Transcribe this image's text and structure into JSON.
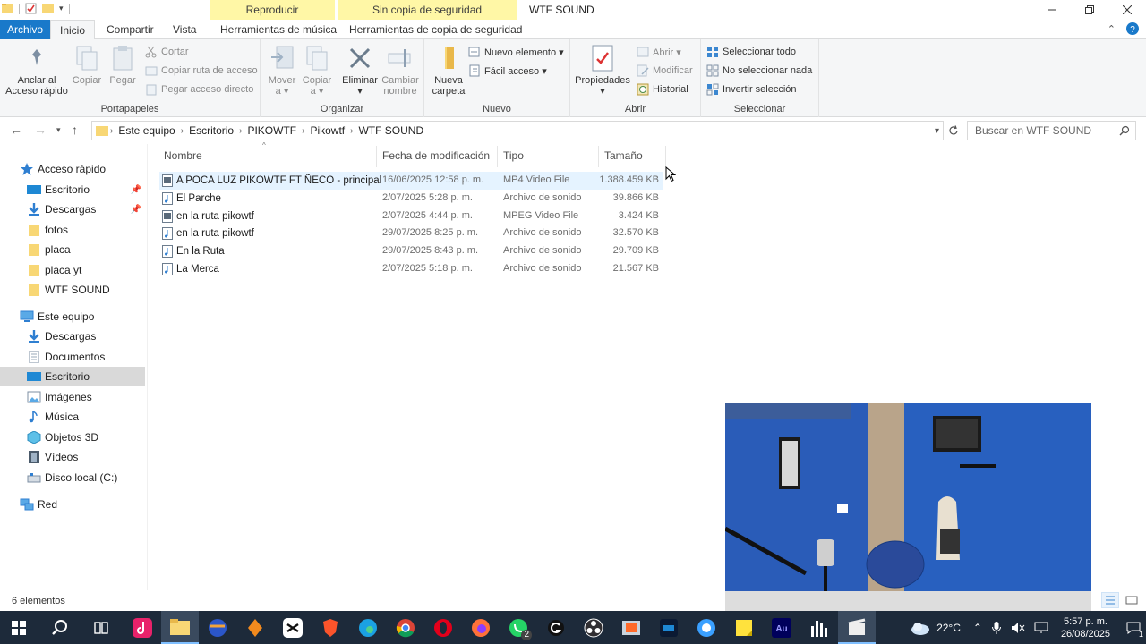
{
  "titlebar": {
    "context_tab_1": "Reproducir",
    "context_tab_2": "Sin copia de seguridad",
    "window_title": "WTF SOUND"
  },
  "tabs": {
    "file": "Archivo",
    "home": "Inicio",
    "share": "Compartir",
    "view": "Vista",
    "music_tools": "Herramientas de música",
    "backup_tools": "Herramientas de copia de seguridad"
  },
  "ribbon": {
    "clipboard": {
      "label": "Portapapeles",
      "pin_quick_access": [
        "Anclar al",
        "Acceso rápido"
      ],
      "copy": "Copiar",
      "paste": "Pegar",
      "cut": "Cortar",
      "copy_path": "Copiar ruta de acceso",
      "paste_shortcut": "Pegar acceso directo"
    },
    "organize": {
      "label": "Organizar",
      "move_to": [
        "Mover",
        "a ▾"
      ],
      "copy_to": [
        "Copiar",
        "a ▾"
      ],
      "delete": [
        "Eliminar",
        "▾"
      ],
      "rename": [
        "Cambiar",
        "nombre"
      ]
    },
    "new": {
      "label": "Nuevo",
      "new_folder": [
        "Nueva",
        "carpeta"
      ],
      "new_item": "Nuevo elemento ▾",
      "easy_access": "Fácil acceso ▾"
    },
    "open": {
      "label": "Abrir",
      "properties": [
        "Propiedades",
        "▾"
      ],
      "open": "Abrir ▾",
      "edit": "Modificar",
      "history": "Historial"
    },
    "select": {
      "label": "Seleccionar",
      "select_all": "Seleccionar todo",
      "select_none": "No seleccionar nada",
      "invert": "Invertir selección"
    }
  },
  "address": {
    "crumbs": [
      "Este equipo",
      "Escritorio",
      "PIKOWTF",
      "Pikowtf",
      "WTF SOUND"
    ],
    "search_placeholder": "Buscar en WTF SOUND"
  },
  "nav": {
    "quick_access": "Acceso rápido",
    "quick_items": [
      "Escritorio",
      "Descargas",
      "fotos",
      "placa",
      "placa yt",
      "WTF SOUND"
    ],
    "this_pc": "Este equipo",
    "pc_items": [
      "Descargas",
      "Documentos",
      "Escritorio",
      "Imágenes",
      "Música",
      "Objetos 3D",
      "Vídeos",
      "Disco local (C:)"
    ],
    "network": "Red"
  },
  "columns": {
    "name": "Nombre",
    "date": "Fecha de modificación",
    "type": "Tipo",
    "size": "Tamaño"
  },
  "files": [
    {
      "name": "A POCA LUZ PIKOWTF FT ÑECO - principal",
      "date": "16/06/2025 12:58 p. m.",
      "type": "MP4 Video File",
      "size": "1.388.459 KB",
      "icon": "video-file-icon"
    },
    {
      "name": "El Parche",
      "date": "2/07/2025 5:28 p. m.",
      "type": "Archivo de sonido",
      "size": "39.866 KB",
      "icon": "audio-file-icon"
    },
    {
      "name": "en la ruta pikowtf",
      "date": "2/07/2025 4:44 p. m.",
      "type": "MPEG Video File",
      "size": "3.424 KB",
      "icon": "video-file-icon"
    },
    {
      "name": "en la ruta pikowtf",
      "date": "29/07/2025 8:25 p. m.",
      "type": "Archivo de sonido",
      "size": "32.570 KB",
      "icon": "audio-file-icon"
    },
    {
      "name": "En la Ruta",
      "date": "29/07/2025 8:43 p. m.",
      "type": "Archivo de sonido",
      "size": "29.709 KB",
      "icon": "audio-file-icon"
    },
    {
      "name": "La Merca",
      "date": "2/07/2025 5:18 p. m.",
      "type": "Archivo de sonido",
      "size": "21.567 KB",
      "icon": "audio-file-icon"
    }
  ],
  "status": {
    "count": "6 elementos"
  },
  "taskbar": {
    "temperature": "22°C",
    "time": "5:57 p. m.",
    "date": "26/08/2025",
    "whatsapp_badge": "2",
    "notification_count": "1"
  }
}
